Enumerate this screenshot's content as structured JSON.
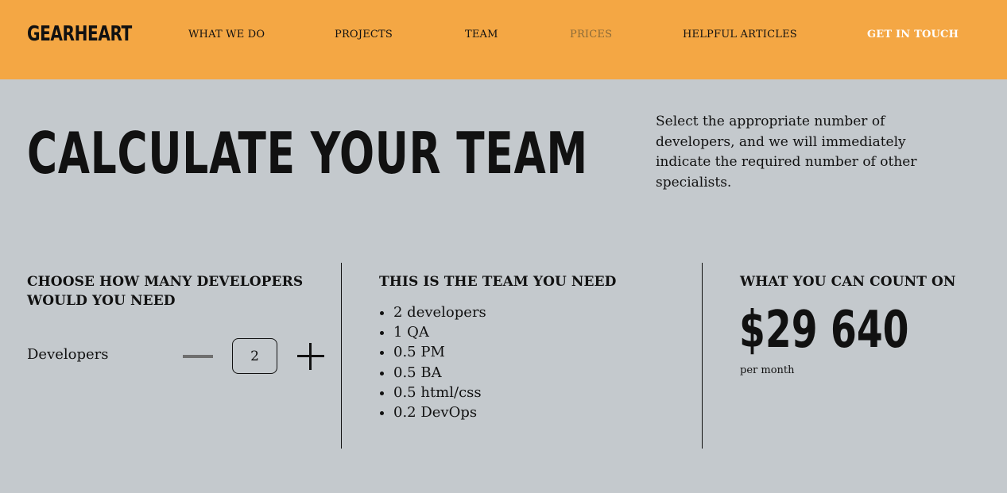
{
  "header": {
    "logo": "GEARHEART",
    "nav": [
      {
        "label": "WHAT WE DO"
      },
      {
        "label": "PROJECTS"
      },
      {
        "label": "TEAM"
      },
      {
        "label": "PRICES"
      },
      {
        "label": "HELPFUL ARTICLES"
      }
    ],
    "cta": "GET IN TOUCH",
    "colors": {
      "background": "#f4a744",
      "active_link": "#8a6a38",
      "cta": "#ffffff"
    }
  },
  "hero": {
    "title": "CALCULATE YOUR TEAM",
    "description": "Select the appropriate number of developers, and we will immediately indicate the required number of other specialists."
  },
  "calculator": {
    "choose_heading": "CHOOSE HOW MANY DEVELOPERS WOULD YOU NEED",
    "developers_label": "Developers",
    "developers_count": "2",
    "minus_icon": "minus-icon",
    "plus_icon": "plus-icon",
    "team_heading": "THIS IS THE TEAM YOU NEED",
    "team": [
      "2 developers",
      "1 QA",
      "0.5 PM",
      "0.5 BA",
      "0.5 html/css",
      "0.2 DevOps"
    ],
    "count_heading": "WHAT YOU CAN COUNT ON",
    "price": "$29 640",
    "price_period": "per month"
  },
  "colors": {
    "page_background": "#c4c9cd"
  }
}
